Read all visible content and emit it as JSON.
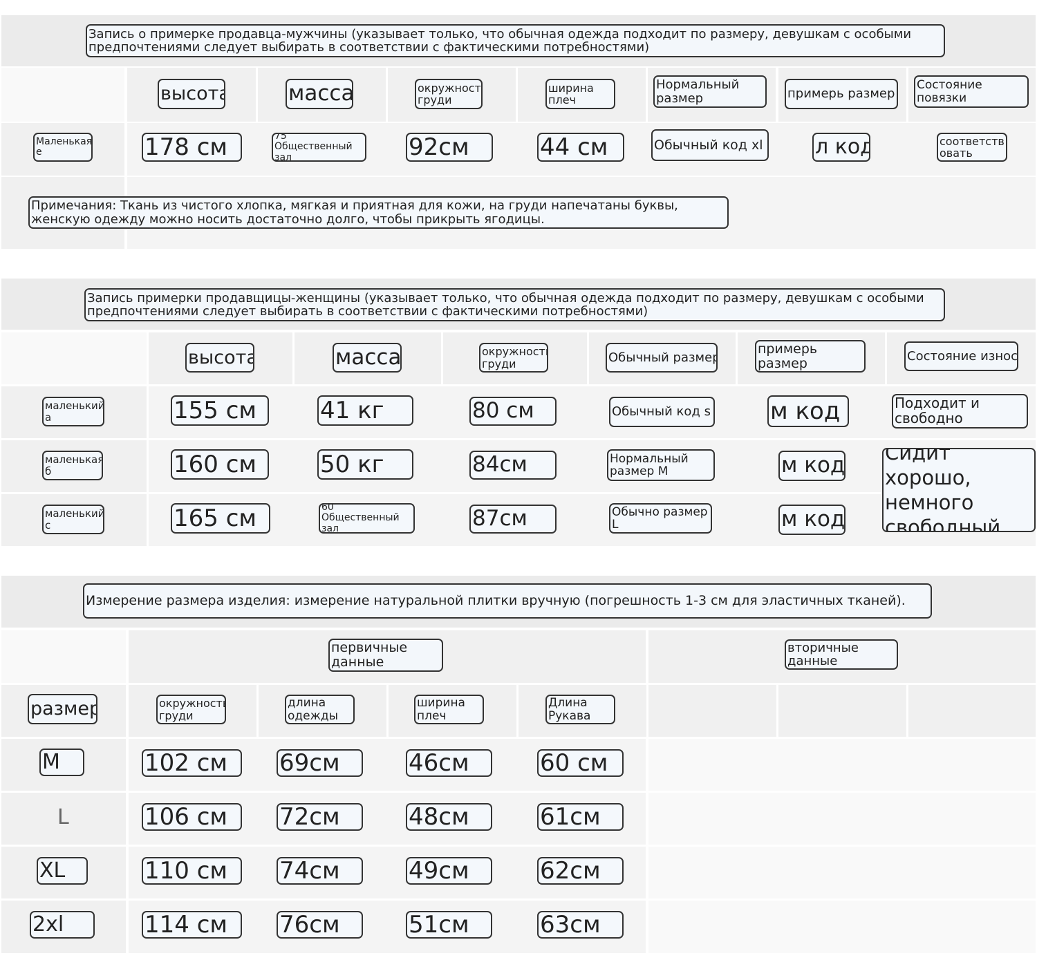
{
  "male_section": {
    "title": "Запись о примерке продавца-мужчины (указывает только, что обычная одежда подходит по размеру, девушкам с особыми предпочтениями следует выбирать в соответствии с фактическими потребностями)",
    "headers": [
      "высота",
      "масса",
      "окружность груди",
      "ширина плеч",
      "Нормальный размер",
      "примерь размер",
      "Состояние повязки"
    ],
    "row": {
      "label": "Маленькая е",
      "values": [
        "178 см",
        "75 Общественный зал",
        "92см",
        "44 см",
        "Обычный код xl",
        "л код",
        "соответств овать"
      ]
    },
    "note": "Примечания: Ткань из чистого хлопка, мягкая и приятная для кожи, на груди напечатаны буквы, женскую одежду можно носить достаточно долго, чтобы прикрыть ягодицы."
  },
  "female_section": {
    "title": "Запись примерки продавщицы-женщины (указывает только, что обычная одежда подходит по размеру, девушкам с особыми предпочтениями следует выбирать в соответствии с фактическими потребностями)",
    "headers": [
      "высота",
      "масса",
      "окружность груди",
      "Обычный размер",
      "примерь размер",
      "Состояние износа"
    ],
    "rows": [
      {
        "label": "маленький а",
        "height": "155 см",
        "weight": "41 кг",
        "chest": "80 см",
        "normal": "Обычный код s",
        "tried": "м код"
      },
      {
        "label": "маленькая б",
        "height": "160 см",
        "weight": "50 кг",
        "chest": "84см",
        "normal": "Нормальный размер M",
        "tried": "м код"
      },
      {
        "label": "маленький с",
        "height": "165 см",
        "weight": "60 Общественный зал",
        "chest": "87см",
        "normal": "Обычно размер L",
        "tried": "м код"
      }
    ],
    "wear_states": [
      "Подходит и свободно",
      "Сидит хорошо, немного свободный"
    ]
  },
  "measure_section": {
    "title": "Измерение размера изделия: измерение натуральной плитки вручную (погрешность 1-3 см для эластичных тканей).",
    "primary_label": "первичные данные",
    "secondary_label": "вторичные данные",
    "size_header": "размер",
    "col_headers": [
      "окружность груди",
      "длина одежды",
      "ширина плеч",
      "Длина Рукава"
    ],
    "rows": [
      {
        "size": "M",
        "chest": "102 см",
        "length": "69см",
        "shoulder": "46см",
        "sleeve": "60 см"
      },
      {
        "size": "L",
        "chest": "106 см",
        "length": "72см",
        "shoulder": "48см",
        "sleeve": "61см"
      },
      {
        "size": "XL",
        "chest": "110 см",
        "length": "74см",
        "shoulder": "49см",
        "sleeve": "62см"
      },
      {
        "size": "2xl",
        "chest": "114 см",
        "length": "76см",
        "shoulder": "51см",
        "sleeve": "63см"
      }
    ]
  }
}
